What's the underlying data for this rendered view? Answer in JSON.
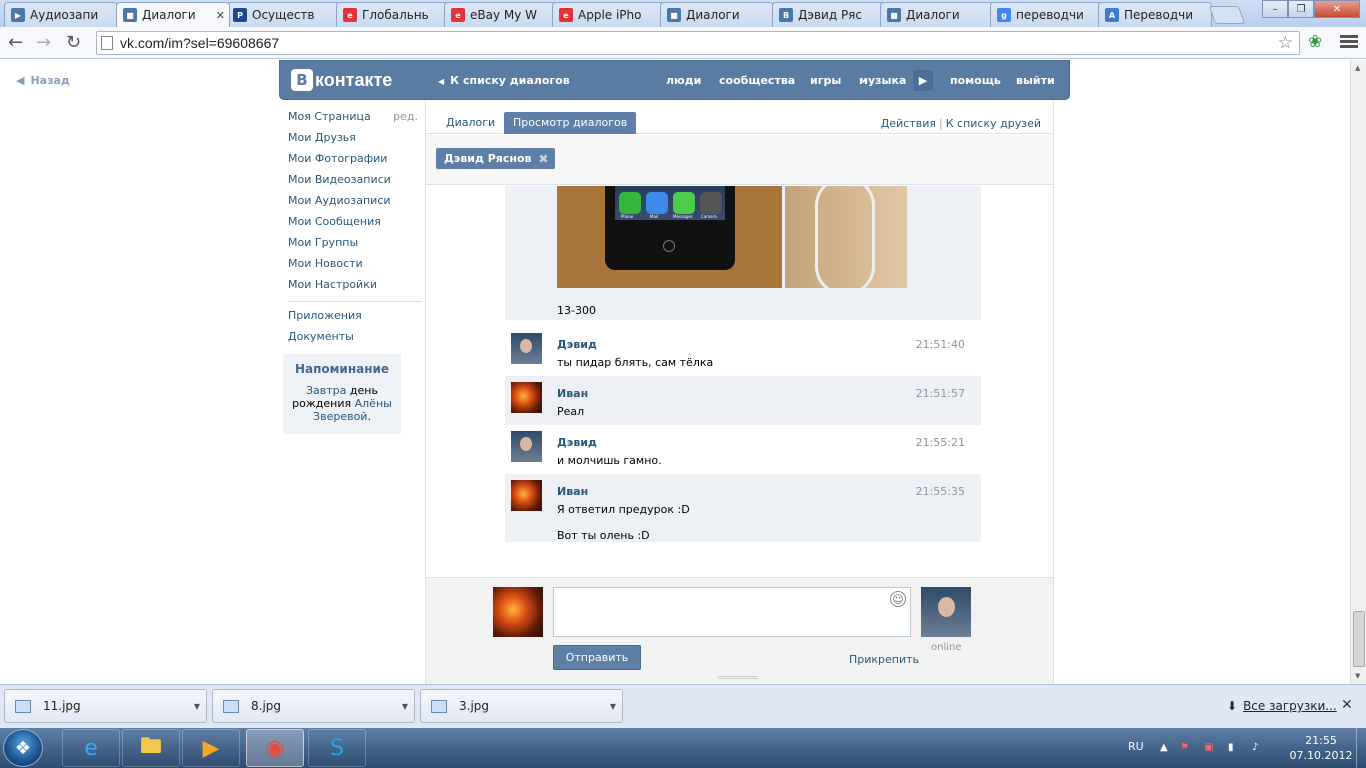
{
  "browser": {
    "tabs": [
      {
        "title": "Аудиозапи",
        "icon": "play-icon",
        "color": "#4a76a8"
      },
      {
        "title": "Диалоги",
        "icon": "chat-icon",
        "color": "#4a76a8"
      },
      {
        "title": "Осуществ",
        "icon": "paypal-icon",
        "color": "#1e4b8f"
      },
      {
        "title": "Глобальнь",
        "icon": "ebay-icon",
        "color": "#e53238"
      },
      {
        "title": "eBay My W",
        "icon": "ebay-icon",
        "color": "#e53238"
      },
      {
        "title": "Apple iPho",
        "icon": "ebay-icon",
        "color": "#e53238"
      },
      {
        "title": "Диалоги",
        "icon": "chat-icon",
        "color": "#4a76a8"
      },
      {
        "title": "Дэвид Ряс",
        "icon": "vk-icon",
        "color": "#4a76a8"
      },
      {
        "title": "Диалоги",
        "icon": "chat-icon",
        "color": "#4a76a8"
      },
      {
        "title": "переводчи",
        "icon": "google-icon",
        "color": "#4285f4"
      },
      {
        "title": "Переводчи",
        "icon": "translate-icon",
        "color": "#3a7bd5"
      }
    ],
    "active_tab": 1,
    "url": "vk.com/im?sel=69608667"
  },
  "page": {
    "back_link": "Назад",
    "header": {
      "logo_letter": "В",
      "logo_text": "контакте",
      "back_to_list": "К списку диалогов",
      "menu": [
        "люди",
        "сообщества",
        "игры",
        "музыка",
        "помощь",
        "выйти"
      ]
    },
    "sidebar": {
      "items": [
        {
          "label": "Моя Страница",
          "extra": "ред."
        },
        {
          "label": "Мои Друзья"
        },
        {
          "label": "Мои Фотографии"
        },
        {
          "label": "Мои Видеозаписи"
        },
        {
          "label": "Мои Аудиозаписи"
        },
        {
          "label": "Мои Сообщения"
        },
        {
          "label": "Мои Группы"
        },
        {
          "label": "Мои Новости"
        },
        {
          "label": "Мои Настройки"
        }
      ],
      "extra_items": [
        "Приложения",
        "Документы"
      ],
      "reminder": {
        "title": "Напоминание",
        "tomorrow": "Завтра",
        "text_mid": "день рождения",
        "name": "Алёны Зверевой",
        "dot": "."
      }
    },
    "dialog": {
      "tabs": [
        "Диалоги",
        "Просмотр диалогов"
      ],
      "actions": [
        "Действия",
        "К списку друзей"
      ],
      "separator": "|",
      "peer_chip": "Дэвид Ряснов",
      "photo_caption": "13-300",
      "app_labels": [
        "Phone",
        "Mail",
        "Messages",
        "Camera"
      ],
      "messages": [
        {
          "author": "Дэвид",
          "time": "21:51:40",
          "lines": [
            "ты пидар блять, сам тёлка"
          ],
          "avatar": "david"
        },
        {
          "author": "Иван",
          "time": "21:51:57",
          "lines": [
            "Реал"
          ],
          "avatar": "ivan"
        },
        {
          "author": "Дэвид",
          "time": "21:55:21",
          "lines": [
            "и молчишь гамно."
          ],
          "avatar": "david"
        },
        {
          "author": "Иван",
          "time": "21:55:35",
          "lines": [
            "Я ответил предурок :D",
            "Вот ты олень :D"
          ],
          "avatar": "ivan"
        }
      ],
      "composer": {
        "send_label": "Отправить",
        "attach_label": "Прикрепить",
        "online_label": "online",
        "message_value": ""
      }
    }
  },
  "downloads": {
    "items": [
      "11.jpg",
      "8.jpg",
      "3.jpg"
    ],
    "all_label": "Все загрузки..."
  },
  "taskbar": {
    "apps": [
      "ie-icon",
      "explorer-icon",
      "media-player-icon",
      "chrome-icon",
      "skype-icon"
    ],
    "active_app": 3,
    "lang": "RU",
    "time": "21:55",
    "date": "07.10.2012"
  }
}
